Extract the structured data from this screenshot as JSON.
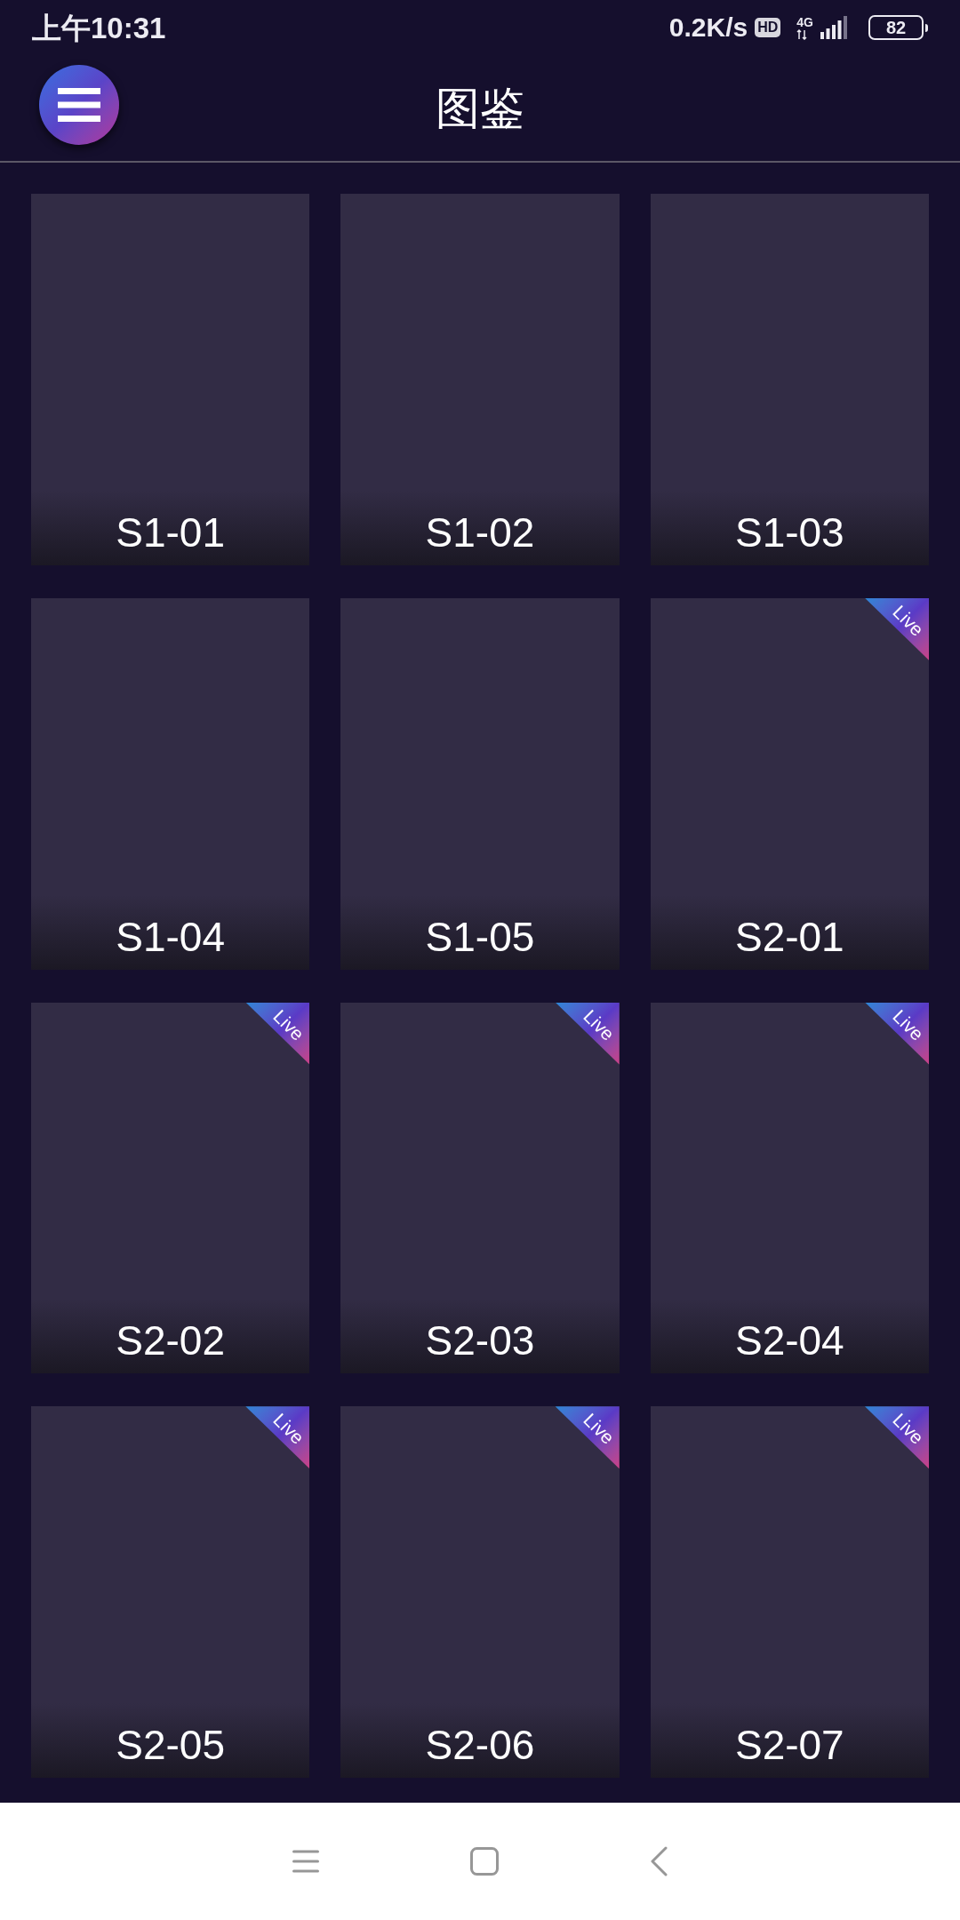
{
  "status_bar": {
    "time": "上午10:31",
    "net_speed": "0.2K/s",
    "hd_badge": "HD",
    "network_type": "4G",
    "battery": "82"
  },
  "header": {
    "title": "图鉴"
  },
  "cards": [
    {
      "label": "S1-01"
    },
    {
      "label": "S1-02"
    },
    {
      "label": "S1-03"
    },
    {
      "label": "S1-04"
    },
    {
      "label": "S1-05"
    },
    {
      "label": "S2-01",
      "badge": "Live"
    },
    {
      "label": "S2-02",
      "badge": "Live"
    },
    {
      "label": "S2-03",
      "badge": "Live"
    },
    {
      "label": "S2-04",
      "badge": "Live"
    },
    {
      "label": "S2-05",
      "badge": "Live"
    },
    {
      "label": "S2-06",
      "badge": "Live"
    },
    {
      "label": "S2-07",
      "badge": "Live"
    }
  ]
}
